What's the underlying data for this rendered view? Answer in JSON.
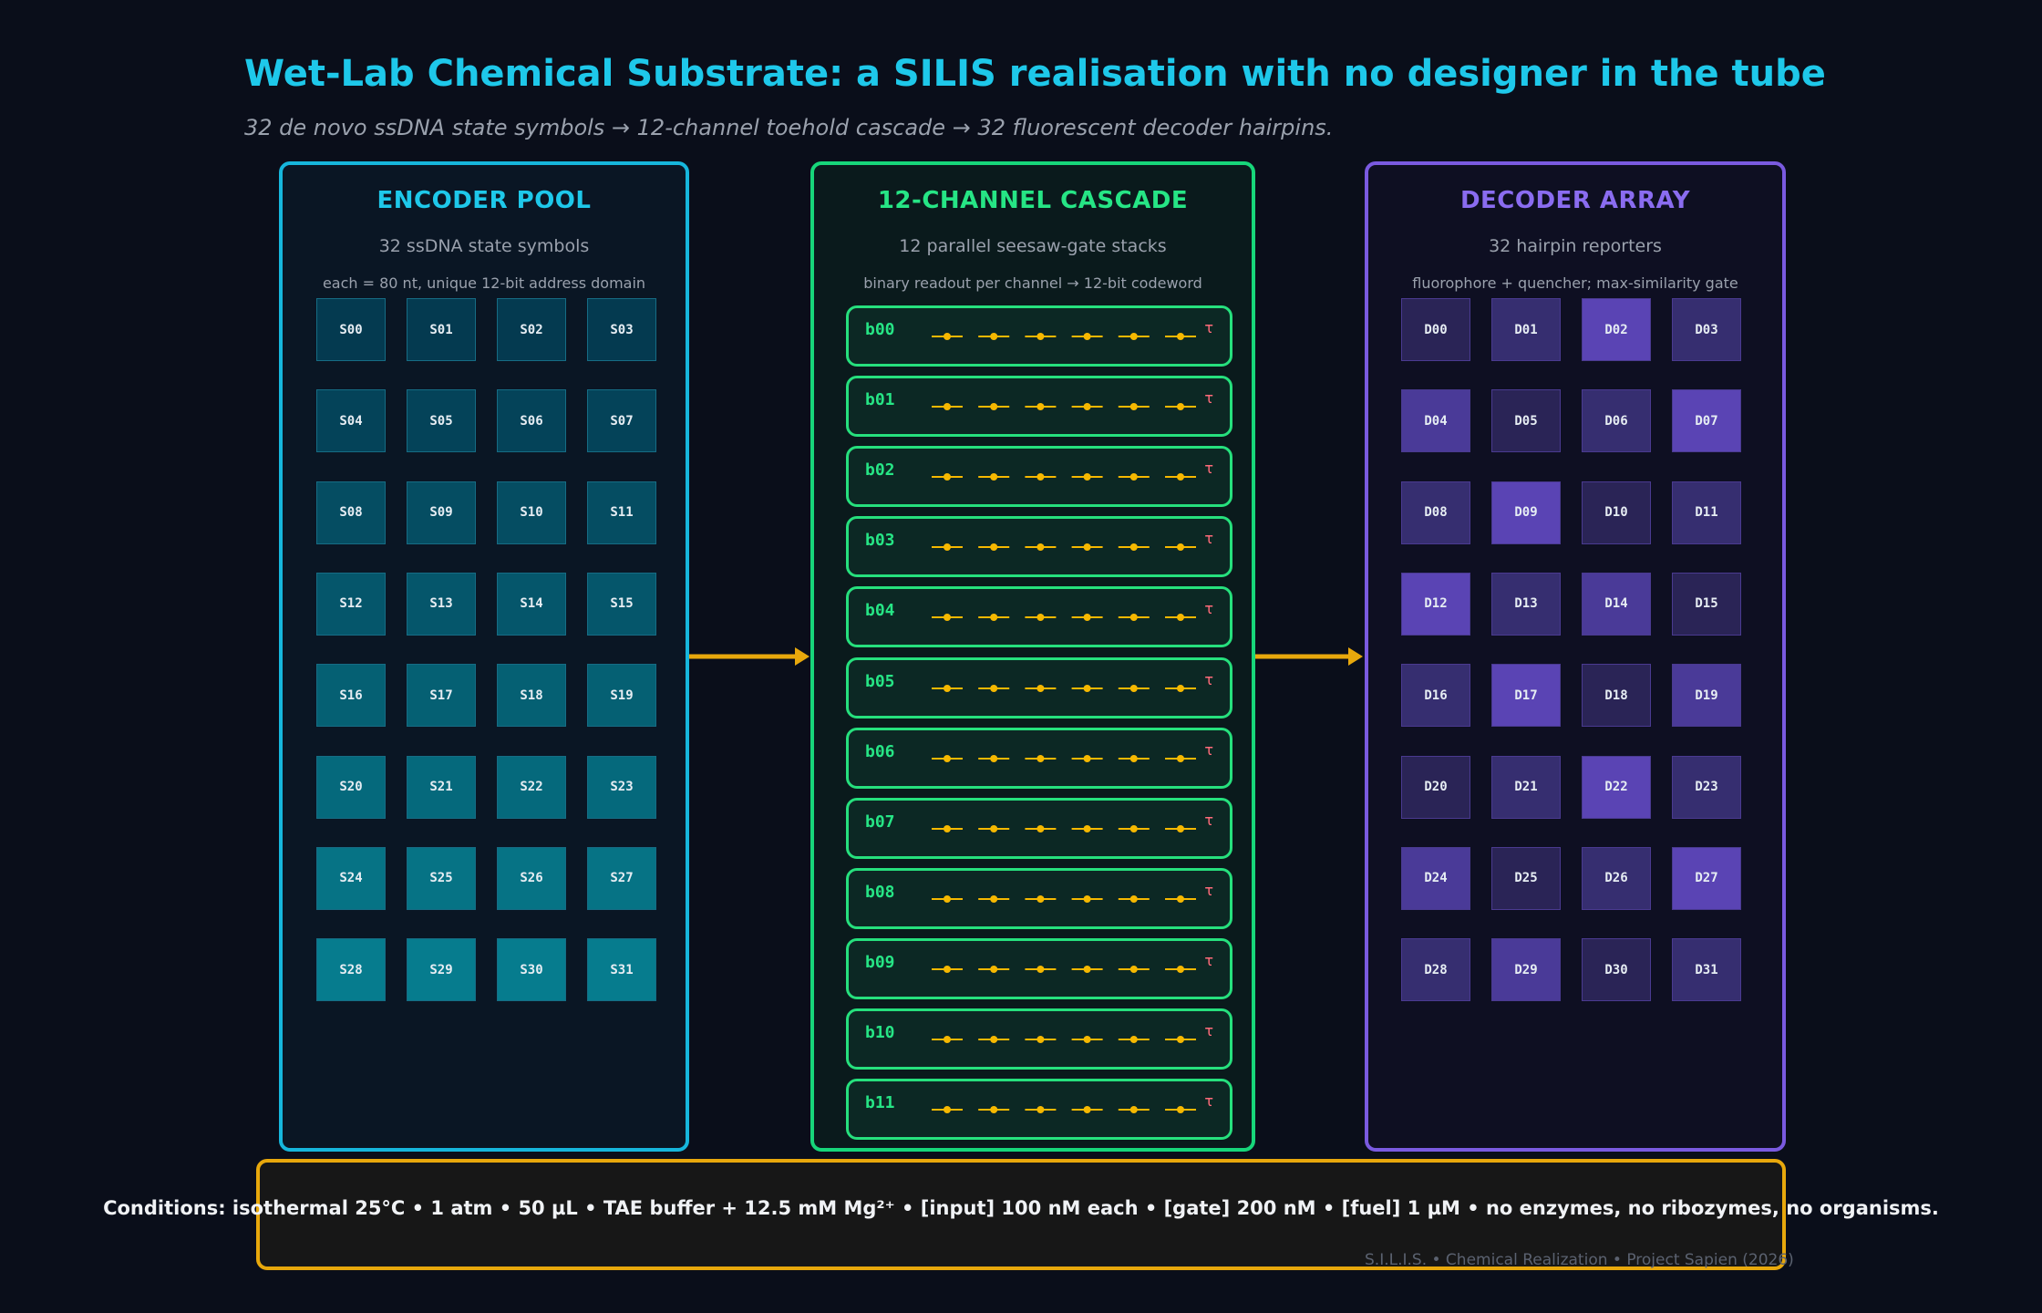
{
  "title": "Wet-Lab Chemical Substrate: a SILIS realisation with no designer in the tube",
  "subtitle": "32 de novo ssDNA state symbols  →  12-channel toehold cascade  →  32 fluorescent decoder hairpins.",
  "colors": {
    "encoder": "#16b6dc",
    "cascade": "#17d67a",
    "decoder": "#7a5ae0",
    "arrow": "#e8a80c",
    "tau": "#ff6b7a",
    "gate_dot": "#f6b800"
  },
  "encoder": {
    "title": "ENCODER POOL",
    "subtitle": "32 ssDNA state symbols",
    "desc": "each = 80 nt, unique 12-bit address domain",
    "cells": [
      "S00",
      "S01",
      "S02",
      "S03",
      "S04",
      "S05",
      "S06",
      "S07",
      "S08",
      "S09",
      "S10",
      "S11",
      "S12",
      "S13",
      "S14",
      "S15",
      "S16",
      "S17",
      "S18",
      "S19",
      "S20",
      "S21",
      "S22",
      "S23",
      "S24",
      "S25",
      "S26",
      "S27",
      "S28",
      "S29",
      "S30",
      "S31"
    ]
  },
  "cascade": {
    "title": "12-CHANNEL CASCADE",
    "subtitle": "12 parallel seesaw-gate stacks",
    "desc": "binary readout per channel  →  12-bit codeword",
    "tau_symbol": "τ",
    "gates_per_channel": 6,
    "channels": [
      "b00",
      "b01",
      "b02",
      "b03",
      "b04",
      "b05",
      "b06",
      "b07",
      "b08",
      "b09",
      "b10",
      "b11"
    ]
  },
  "decoder": {
    "title": "DECODER ARRAY",
    "subtitle": "32 hairpin reporters",
    "desc": "fluorophore + quencher; max-similarity gate",
    "cells": [
      {
        "label": "D00",
        "shade": 1
      },
      {
        "label": "D01",
        "shade": 2
      },
      {
        "label": "D02",
        "shade": 4
      },
      {
        "label": "D03",
        "shade": 2
      },
      {
        "label": "D04",
        "shade": 3
      },
      {
        "label": "D05",
        "shade": 1
      },
      {
        "label": "D06",
        "shade": 2
      },
      {
        "label": "D07",
        "shade": 4
      },
      {
        "label": "D08",
        "shade": 2
      },
      {
        "label": "D09",
        "shade": 4
      },
      {
        "label": "D10",
        "shade": 1
      },
      {
        "label": "D11",
        "shade": 2
      },
      {
        "label": "D12",
        "shade": 4
      },
      {
        "label": "D13",
        "shade": 2
      },
      {
        "label": "D14",
        "shade": 3
      },
      {
        "label": "D15",
        "shade": 1
      },
      {
        "label": "D16",
        "shade": 2
      },
      {
        "label": "D17",
        "shade": 4
      },
      {
        "label": "D18",
        "shade": 1
      },
      {
        "label": "D19",
        "shade": 3
      },
      {
        "label": "D20",
        "shade": 1
      },
      {
        "label": "D21",
        "shade": 2
      },
      {
        "label": "D22",
        "shade": 4
      },
      {
        "label": "D23",
        "shade": 2
      },
      {
        "label": "D24",
        "shade": 3
      },
      {
        "label": "D25",
        "shade": 1
      },
      {
        "label": "D26",
        "shade": 2
      },
      {
        "label": "D27",
        "shade": 4
      },
      {
        "label": "D28",
        "shade": 2
      },
      {
        "label": "D29",
        "shade": 3
      },
      {
        "label": "D30",
        "shade": 1
      },
      {
        "label": "D31",
        "shade": 2
      }
    ]
  },
  "conditions": "Conditions:  isothermal 25°C  •  1 atm  •  50 µL  •  TAE buffer + 12.5 mM Mg²⁺  •  [input] 100 nM each  •  [gate] 200 nM  •  [fuel] 1 µM  •  no enzymes, no ribozymes, no organisms.",
  "credit": "S.I.L.I.S. • Chemical Realization • Project Sapien (2026)"
}
